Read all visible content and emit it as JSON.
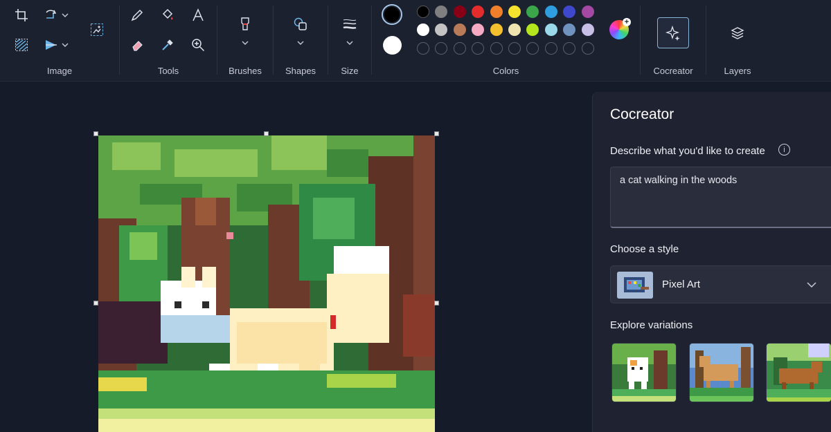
{
  "ribbon": {
    "groups": {
      "image": "Image",
      "tools": "Tools",
      "brushes": "Brushes",
      "shapes": "Shapes",
      "size": "Size",
      "colors": "Colors",
      "cocreator": "Cocreator",
      "layers": "Layers"
    },
    "current_colors": {
      "primary": "#000000",
      "secondary": "#ffffff"
    },
    "palette_row1": [
      "#000000",
      "#7f7f7f",
      "#880015",
      "#e42c2c",
      "#f07f2c",
      "#f5e22e",
      "#3aa549",
      "#2e9ee0",
      "#3f48cc",
      "#a349a4"
    ],
    "palette_row2": [
      "#ffffff",
      "#c3c3c3",
      "#b97a57",
      "#f5a9c2",
      "#f5c02e",
      "#efe4b0",
      "#b5e61d",
      "#99d9ea",
      "#7092be",
      "#c8bfe7"
    ]
  },
  "panel": {
    "title": "Cocreator",
    "describe_label": "Describe what you'd like to create",
    "info_icon": "i",
    "prompt_value": "a cat walking in the woods",
    "style_label": "Choose a style",
    "style_value": "Pixel Art",
    "variations_label": "Explore variations"
  }
}
